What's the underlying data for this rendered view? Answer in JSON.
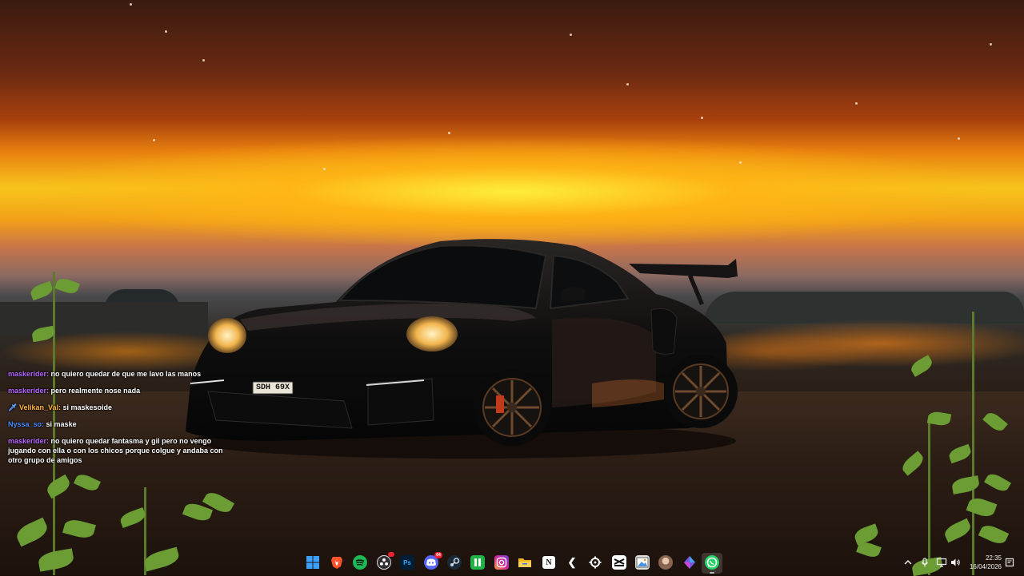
{
  "chat": {
    "messages": [
      {
        "user": "maskerider:",
        "user_color": "#b565ff",
        "text": "no quiero quedar de que me lavo las manos"
      },
      {
        "user": "maskerider:",
        "user_color": "#b565ff",
        "text": "pero realmente nose nada"
      },
      {
        "user": "Velikan_Val:",
        "user_color": "#ffb43c",
        "text": "si maskesoide",
        "icon": "sword-icon"
      },
      {
        "user": "Nyssa_so:",
        "user_color": "#4a8dff",
        "text": "si maske"
      },
      {
        "user": "maskerider:",
        "user_color": "#b565ff",
        "text": "no quiero quedar fantasma y gil pero no vengo jugando con ella o con los chicos porque colgue y andaba con otro grupo de amigos"
      }
    ]
  },
  "car": {
    "plate": "SDH 69X"
  },
  "taskbar": {
    "apps": [
      {
        "name": "windows-start-icon",
        "color": "#3aa0ff"
      },
      {
        "name": "brave-browser-icon",
        "color": "#fb542b"
      },
      {
        "name": "spotify-icon",
        "color": "#1db954"
      },
      {
        "name": "obs-studio-icon",
        "color": "#302e31"
      },
      {
        "name": "photoshop-icon",
        "color": "#001e36",
        "label": "Ps"
      },
      {
        "name": "discord-icon",
        "color": "#5865f2",
        "badge": "64"
      },
      {
        "name": "steam-icon",
        "color": "#1b2838"
      },
      {
        "name": "notes-app-icon",
        "color": "#21b345"
      },
      {
        "name": "instagram-icon",
        "color": "#d6249f"
      },
      {
        "name": "file-explorer-icon",
        "color": "#f3b81f"
      },
      {
        "name": "notion-icon",
        "color": "#ffffff"
      },
      {
        "name": "cursor-arrow-icon",
        "color": "#222222"
      },
      {
        "name": "gear-icon",
        "color": "#222222"
      },
      {
        "name": "capcut-icon",
        "color": "#111111"
      },
      {
        "name": "image-viewer-icon",
        "color": "#dddddd"
      },
      {
        "name": "avatar-icon",
        "color": "#c9a48a"
      },
      {
        "name": "crystal-app-icon",
        "color": "#7a55e0"
      },
      {
        "name": "whatsapp-icon",
        "color": "#25d366",
        "active": true
      }
    ],
    "tray": [
      {
        "name": "chevron-up-icon",
        "glyph": "^"
      },
      {
        "name": "microphone-icon",
        "glyph": "🎙"
      },
      {
        "name": "network-icon",
        "glyph": "🖥"
      },
      {
        "name": "volume-icon",
        "glyph": "🔊"
      }
    ],
    "time": "22:35",
    "date": "16/04/2026"
  }
}
